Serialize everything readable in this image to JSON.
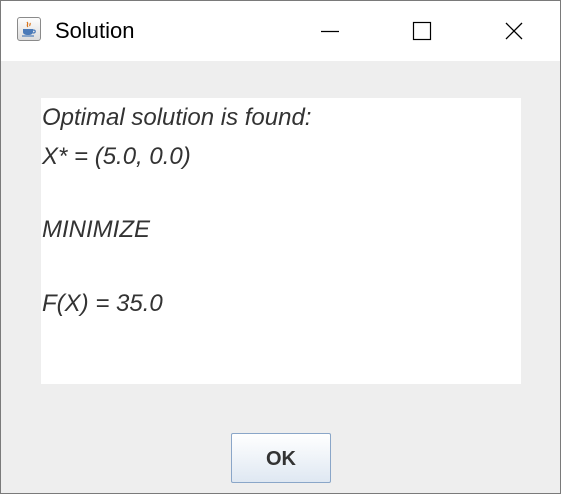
{
  "window": {
    "title": "Solution",
    "icon": "java-cup-icon"
  },
  "controls": {
    "minimize_icon": "minimize-icon",
    "maximize_icon": "maximize-icon",
    "close_icon": "close-icon"
  },
  "message": {
    "line1": "Optimal solution is found:",
    "line2": "X* = (5.0, 0.0)",
    "line3": "MINIMIZE",
    "line4": "F(X) = 35.0"
  },
  "buttons": {
    "ok_label": "OK"
  },
  "colors": {
    "title_bar": "#ffffff",
    "dialog_background": "#eeeeee",
    "text": "#333333",
    "java_cup": "#d8731a"
  }
}
